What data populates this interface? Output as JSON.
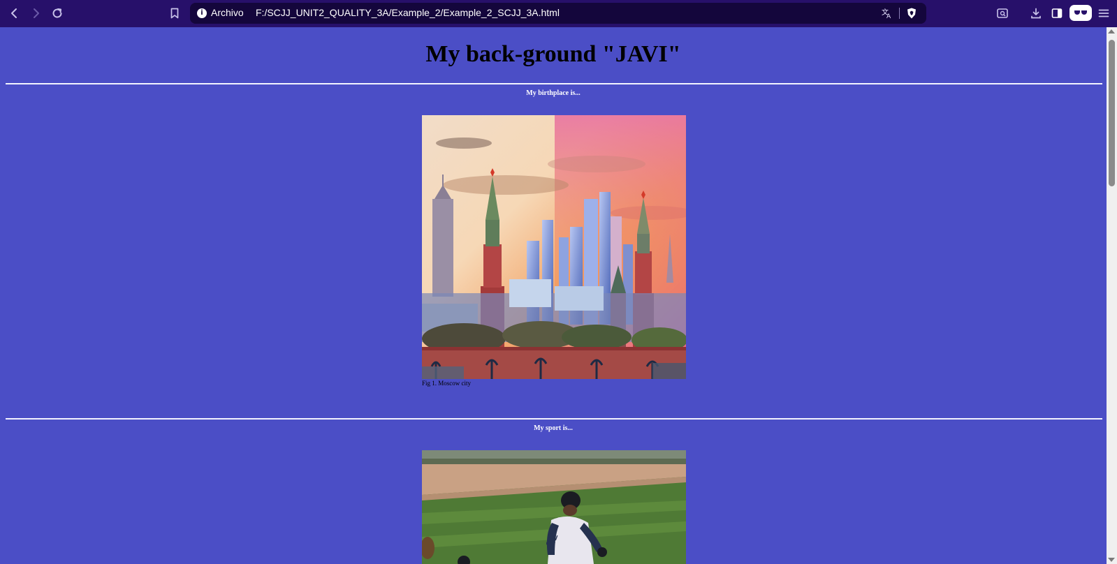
{
  "browser": {
    "scheme_label": "Archivo",
    "url": "F:/SCJJ_UNIT2_QUALITY_3A/Example_2/Example_2_SCJJ_3A.html",
    "icons": {
      "back": "back-arrow-icon",
      "forward": "forward-arrow-icon",
      "reload": "reload-icon",
      "bookmark": "bookmark-icon",
      "site_info": "info-icon",
      "translate": "translate-icon",
      "shields": "brave-shields-icon",
      "screenshot": "screenshot-icon",
      "downloads": "download-icon",
      "sidebar": "sidebar-icon",
      "reader": "reader-mode-icon",
      "menu": "menu-icon"
    }
  },
  "page": {
    "title": "My back-ground \"JAVI\"",
    "sections": [
      {
        "heading": "My birthplace is...",
        "caption": "Fig 1. Moscow city",
        "image": "Moscow city skyline with Kremlin towers at sunset"
      },
      {
        "heading": "My sport is...",
        "image": "Baseball player running on the field"
      }
    ],
    "colors": {
      "background": "#4b4ec6",
      "toolbar": "#27106a",
      "url_bar": "#14063c",
      "rule": "#f3f3ff"
    }
  }
}
